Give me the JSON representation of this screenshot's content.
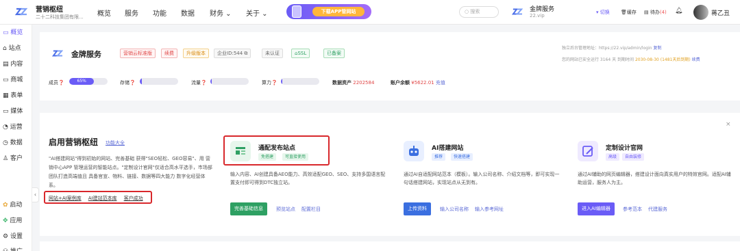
{
  "topbar": {
    "brand_title": "营销枢纽",
    "brand_sub": "二十二科技集团有限...",
    "nav": [
      "概览",
      "服务",
      "功能",
      "数据",
      "财务 ⌄",
      "关于 ⌄"
    ],
    "download_label": "下载APP管网站",
    "search_placeholder": "搜索",
    "account_name": "金牌服务",
    "account_domain": "22.vip",
    "switch_label": "▾ 切换",
    "cache_label": "缓存",
    "todo_label": "待办",
    "todo_count": "(4)",
    "user_name": "蒋乙丑"
  },
  "sidebar": {
    "top_items": [
      "概览",
      "站点",
      "内容",
      "商城",
      "表单",
      "媒体",
      "运营",
      "数据",
      "客户"
    ],
    "bottom_items": [
      "启动",
      "应用",
      "设置",
      "推广"
    ],
    "collapse": "‹"
  },
  "site_card": {
    "name": "金牌服务",
    "tags": [
      "营销云标准版",
      "续费",
      "升级版本",
      "企业ID:544",
      "未认证",
      "SSL",
      "已备案"
    ],
    "admin_url_label": "独立后台管理地址：https://22.vip/admin/login",
    "copy_label": "复制",
    "safe_running": "您的网站已安全运行 3164 天",
    "expire_label": "到期时间",
    "expire_date": "2030-08-30 (1481天后到期)",
    "renew_label": "续费",
    "stats": [
      {
        "label": "成员",
        "percent": 65,
        "text": "65%"
      },
      {
        "label": "存储",
        "percent": 6,
        "text": ""
      },
      {
        "label": "流量",
        "percent": 4,
        "text": ""
      },
      {
        "label": "算力",
        "percent": 4,
        "text": ""
      }
    ],
    "data_assets_label": "数据资产",
    "data_assets_value": "2202584",
    "balance_label": "账户余额",
    "balance_value": "¥5622.01",
    "recharge_label": "充值"
  },
  "onboarding": {
    "close": "×",
    "title": "启用营销枢纽",
    "title_link": "功能大全",
    "desc": "\"AI搭建网站\"得到初始的网站、完善基础 获得\"SEO轻松、GEO容易\"、用 营销中心APP 管理运营的智能站点。\"定制设计官网\"仅适合高水平选手，市场部团队打造高端值且 具备官宣、物料、链接、数据等四大能力 数字化经营体系。",
    "links": [
      "网站+AI案例库",
      "AI建站范本库",
      "客户成功"
    ],
    "features": [
      {
        "title": "通配发布站点",
        "tags": [
          "免搭建",
          "可直接使用"
        ],
        "desc": "输入内容、AI创建具备AEO能力、高效适配GEO、SEO、支持多国语言配置支付即可得到DTC独立站。",
        "button": "完善基础信息",
        "links": [
          "预览站点",
          "配置栏目"
        ]
      },
      {
        "title": "AI搭建网站",
        "tags": [
          "推荐",
          "快速搭建"
        ],
        "desc": "通过AI自适配网站范本（模板）。输入公司名称、介绍文档等，即可实现一句话搭建网站，实现站点从无到有。",
        "button": "上传资料",
        "links": [
          "输入公司名称",
          "输入参考网址"
        ]
      },
      {
        "title": "定制设计官网",
        "tags": [
          "高级",
          "自由装修"
        ],
        "desc": "通过AI辅助的网页编辑器，搭建设计面向真实用户的特效官网。适配AI辅助运营，服务人为主。",
        "button": "进入AI编辑器",
        "links": [
          "参考范本",
          "代建服务"
        ]
      }
    ]
  },
  "colors": {
    "accent": "#6a5cf6",
    "highlight": "#d8272b",
    "green": "#2ea063",
    "blue": "#3b6fe0"
  }
}
